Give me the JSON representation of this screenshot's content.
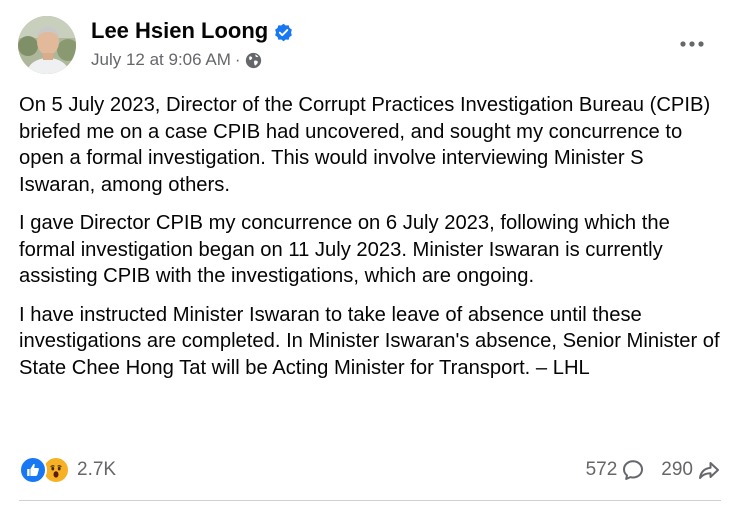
{
  "author": {
    "name": "Lee Hsien Loong",
    "verified": true
  },
  "post_meta": {
    "timestamp": "July 12 at 9:06 AM",
    "separator": "·",
    "audience_icon": "globe-icon"
  },
  "post": {
    "paragraphs": [
      "On 5 July 2023, Director of the Corrupt Practices Investigation Bureau (CPIB) briefed me on a case CPIB had uncovered, and sought my concurrence to open a formal investigation. This would involve interviewing Minister S Iswaran, among others.",
      "I gave Director CPIB my concurrence on 6 July 2023, following which the formal investigation began on 11 July 2023. Minister Iswaran is currently assisting CPIB with the investigations, which are ongoing.",
      "I have instructed Minister Iswaran to take leave of absence until these investigations are completed. In Minister Iswaran's absence, Senior Minister of State Chee Hong Tat will be Acting Minister for Transport. – LHL"
    ]
  },
  "engagement": {
    "reaction_icons": [
      "like-icon",
      "wow-icon"
    ],
    "reaction_count": "2.7K",
    "comment_count": "572",
    "share_count": "290"
  },
  "colors": {
    "text_primary": "#050505",
    "text_secondary": "#65676b",
    "facebook_blue": "#1877f2",
    "wow_yellow": "#f7b125",
    "divider": "#ced0d4"
  }
}
